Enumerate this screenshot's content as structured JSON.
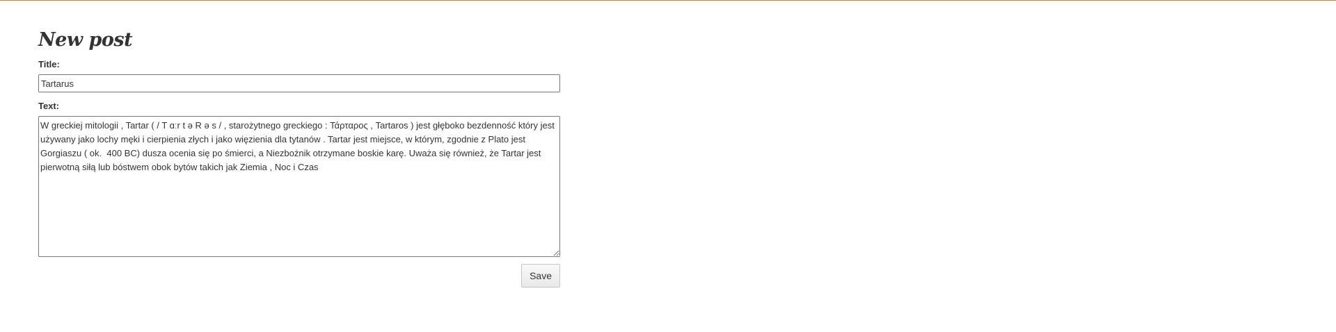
{
  "page": {
    "title": "New post"
  },
  "form": {
    "title_label": "Title:",
    "title_value": "Tartarus",
    "text_label": "Text:",
    "text_value": "W greckiej mitologii , Tartar ( / T ɑːr t ə R ə s / , starożytnego greckiego : Τάρταρος , Tartaros ) jest głęboko bezdenność który jest używany jako lochy męki i cierpienia złych i jako więzienia dla tytanów . Tartar jest miejsce, w którym, zgodnie z Plato jest Gorgiaszu ( ok.  400 BC) dusza ocenia się po śmierci, a Niezbożnik otrzymane boskie karę. Uważa się również, że Tartar jest pierwotną siłą lub bóstwem obok bytów takich jak Ziemia , Noc i Czas",
    "save_label": "Save"
  },
  "colors": {
    "accent_bar": "#cc7a33"
  }
}
